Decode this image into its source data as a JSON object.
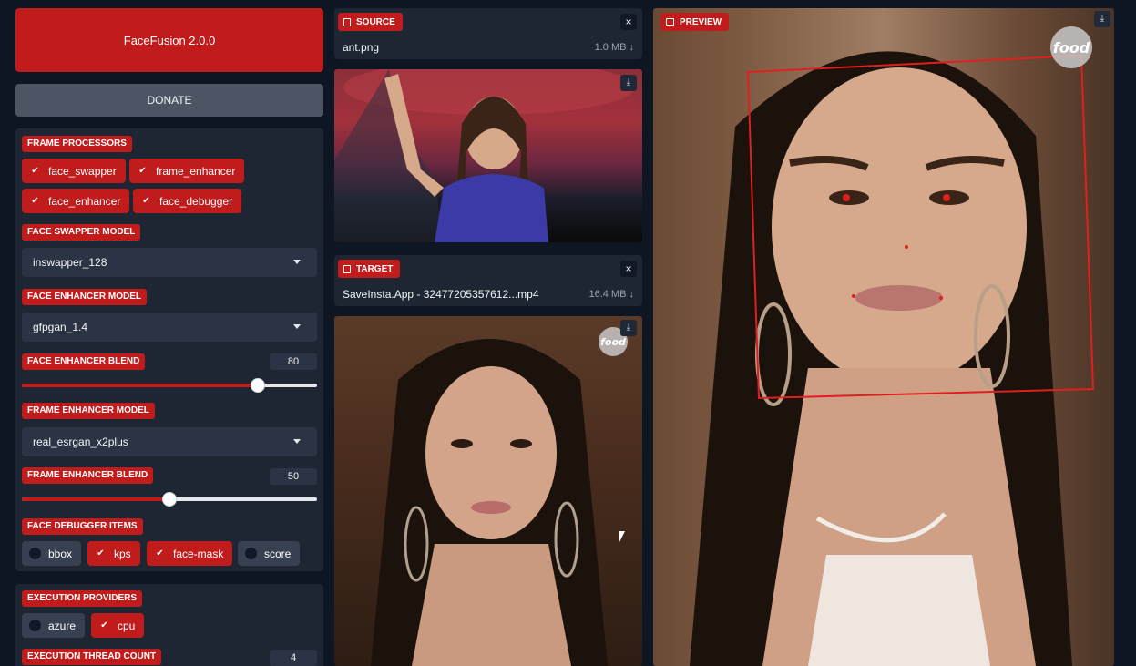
{
  "app": {
    "title": "FaceFusion 2.0.0",
    "donate_label": "DONATE"
  },
  "frame_processors": {
    "label": "FRAME PROCESSORS",
    "items": [
      {
        "label": "face_swapper",
        "checked": true
      },
      {
        "label": "frame_enhancer",
        "checked": true
      },
      {
        "label": "face_enhancer",
        "checked": true
      },
      {
        "label": "face_debugger",
        "checked": true
      }
    ]
  },
  "face_swapper_model": {
    "label": "FACE SWAPPER MODEL",
    "value": "inswapper_128"
  },
  "face_enhancer_model": {
    "label": "FACE ENHANCER MODEL",
    "value": "gfpgan_1.4"
  },
  "face_enhancer_blend": {
    "label": "FACE ENHANCER BLEND",
    "value": "80",
    "fraction": 0.8
  },
  "frame_enhancer_model": {
    "label": "FRAME ENHANCER MODEL",
    "value": "real_esrgan_x2plus"
  },
  "frame_enhancer_blend": {
    "label": "FRAME ENHANCER BLEND",
    "value": "50",
    "fraction": 0.5
  },
  "face_debugger_items": {
    "label": "FACE DEBUGGER ITEMS",
    "items": [
      {
        "label": "bbox",
        "checked": false
      },
      {
        "label": "kps",
        "checked": true
      },
      {
        "label": "face-mask",
        "checked": true
      },
      {
        "label": "score",
        "checked": false
      }
    ]
  },
  "execution_providers": {
    "label": "EXECUTION PROVIDERS",
    "items": [
      {
        "label": "azure",
        "checked": false
      },
      {
        "label": "cpu",
        "checked": true
      }
    ]
  },
  "execution_thread_count": {
    "label": "EXECUTION THREAD COUNT",
    "value": "4"
  },
  "source": {
    "label": "SOURCE",
    "filename": "ant.png",
    "size": "1.0 MB ↓"
  },
  "target": {
    "label": "TARGET",
    "filename": "SaveInsta.App - 32477205357612...mp4",
    "size": "16.4 MB ↓"
  },
  "preview": {
    "label": "PREVIEW"
  },
  "watermark": {
    "text": "food"
  },
  "icons": {
    "close": "×",
    "download": "⤓",
    "check": "✔"
  },
  "colors": {
    "accent": "#c01c1c",
    "panel": "#1e2634",
    "background": "#0f1623"
  }
}
